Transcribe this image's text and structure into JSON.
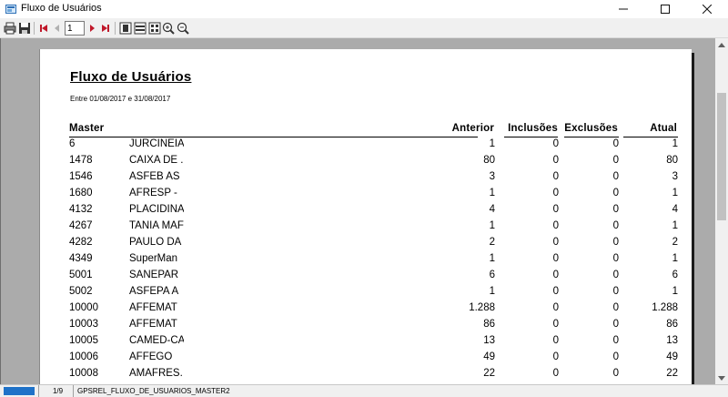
{
  "window": {
    "title": "Fluxo de Usuários"
  },
  "toolbar": {
    "page_value": "1",
    "buttons": [
      "print-icon",
      "save-icon",
      "first-page-icon",
      "prev-page-icon",
      "next-page-icon",
      "last-page-icon",
      "whole-page-icon",
      "page-width-icon",
      "multi-page-icon",
      "zoom-in-icon",
      "zoom-out-icon"
    ]
  },
  "report": {
    "title": "Fluxo de Usuários",
    "subtitle": "Entre 01/08/2017 e 31/08/2017",
    "columns": {
      "master": "Master",
      "anterior": "Anterior",
      "inclusoes": "Inclusões",
      "exclusoes": "Exclusões",
      "atual": "Atual"
    },
    "rows": [
      {
        "code": "6",
        "name": "JURCINEIA",
        "anterior": "1",
        "inclusoes": "0",
        "exclusoes": "0",
        "atual": "1"
      },
      {
        "code": "1478",
        "name": "CAIXA DE .",
        "anterior": "80",
        "inclusoes": "0",
        "exclusoes": "0",
        "atual": "80"
      },
      {
        "code": "1546",
        "name": "ASFEB AS",
        "anterior": "3",
        "inclusoes": "0",
        "exclusoes": "0",
        "atual": "3"
      },
      {
        "code": "1680",
        "name": "AFRESP  -",
        "anterior": "1",
        "inclusoes": "0",
        "exclusoes": "0",
        "atual": "1"
      },
      {
        "code": "4132",
        "name": "PLACIDINA",
        "anterior": "4",
        "inclusoes": "0",
        "exclusoes": "0",
        "atual": "4"
      },
      {
        "code": "4267",
        "name": "TANIA MAF",
        "anterior": "1",
        "inclusoes": "0",
        "exclusoes": "0",
        "atual": "1"
      },
      {
        "code": "4282",
        "name": "PAULO DA",
        "anterior": "2",
        "inclusoes": "0",
        "exclusoes": "0",
        "atual": "2"
      },
      {
        "code": "4349",
        "name": "SuperMan",
        "anterior": "1",
        "inclusoes": "0",
        "exclusoes": "0",
        "atual": "1"
      },
      {
        "code": "5001",
        "name": "SANEPAR",
        "anterior": "6",
        "inclusoes": "0",
        "exclusoes": "0",
        "atual": "6"
      },
      {
        "code": "5002",
        "name": "ASFEPA A",
        "anterior": "1",
        "inclusoes": "0",
        "exclusoes": "0",
        "atual": "1"
      },
      {
        "code": "10000",
        "name": "AFFEMAT",
        "anterior": "1.288",
        "inclusoes": "0",
        "exclusoes": "0",
        "atual": "1.288"
      },
      {
        "code": "10003",
        "name": "AFFEMAT",
        "anterior": "86",
        "inclusoes": "0",
        "exclusoes": "0",
        "atual": "86"
      },
      {
        "code": "10005",
        "name": "CAMED-CA",
        "anterior": "13",
        "inclusoes": "0",
        "exclusoes": "0",
        "atual": "13"
      },
      {
        "code": "10006",
        "name": "AFFEGO",
        "anterior": "49",
        "inclusoes": "0",
        "exclusoes": "0",
        "atual": "49"
      },
      {
        "code": "10008",
        "name": "AMAFRES.",
        "anterior": "22",
        "inclusoes": "0",
        "exclusoes": "0",
        "atual": "22"
      }
    ]
  },
  "statusbar": {
    "page_info": "1/9",
    "report_name": "GPSREL_FLUXO_DE_USUARIOS_MASTER2"
  },
  "colors": {
    "status_progress": "#1f72c8",
    "nav_arrow": "#c0182a",
    "viewport_bg": "#ababab"
  }
}
